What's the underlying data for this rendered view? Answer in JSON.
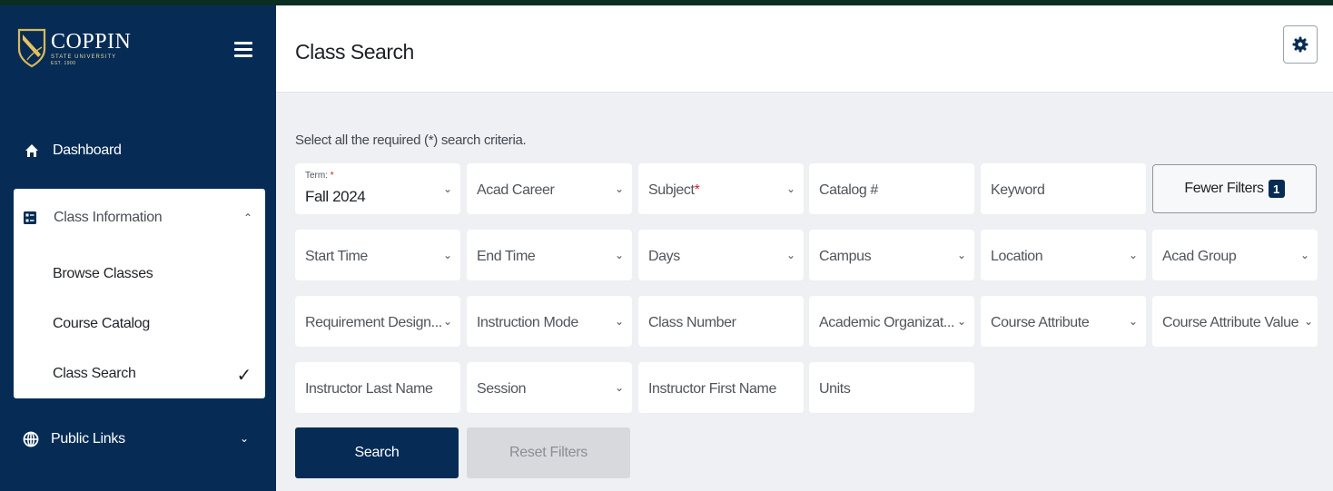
{
  "sidebar": {
    "logo": {
      "name": "COPPIN",
      "subtitle": "STATE UNIVERSITY",
      "est": "EST. 1900"
    },
    "nav": {
      "dashboard": "Dashboard",
      "class_information": "Class Information",
      "sub_items": [
        "Browse Classes",
        "Course Catalog",
        "Class Search"
      ],
      "public_links": "Public Links"
    }
  },
  "header": {
    "title": "Class Search"
  },
  "main": {
    "instructions": "Select all the required (*) search criteria.",
    "term": {
      "label": "Term:",
      "required_mark": "*",
      "value": "Fall 2024"
    },
    "filters": {
      "acad_career": "Acad Career",
      "subject": "Subject",
      "subject_required": "*",
      "catalog": "Catalog #",
      "keyword": "Keyword",
      "start_time": "Start Time",
      "end_time": "End Time",
      "days": "Days",
      "campus": "Campus",
      "location": "Location",
      "acad_group": "Acad Group",
      "requirement_designation": "Requirement Design...",
      "instruction_mode": "Instruction Mode",
      "class_number": "Class Number",
      "academic_organization": "Academic Organizat...",
      "course_attribute": "Course Attribute",
      "course_attribute_value": "Course Attribute Value",
      "instructor_last_name": "Instructor Last Name",
      "session": "Session",
      "instructor_first_name": "Instructor First Name",
      "units": "Units"
    },
    "fewer_filters": {
      "label": "Fewer Filters",
      "count": "1"
    },
    "search_button": "Search",
    "reset_button": "Reset Filters"
  },
  "colors": {
    "navy": "#062c55",
    "gold": "#e9d89c",
    "required": "#c0272d"
  },
  "icons": [
    "home-icon",
    "class-info-icon",
    "globe-icon",
    "gear-icon",
    "hamburger-icon",
    "check-icon",
    "chevron-down-icon",
    "chevron-up-icon"
  ]
}
